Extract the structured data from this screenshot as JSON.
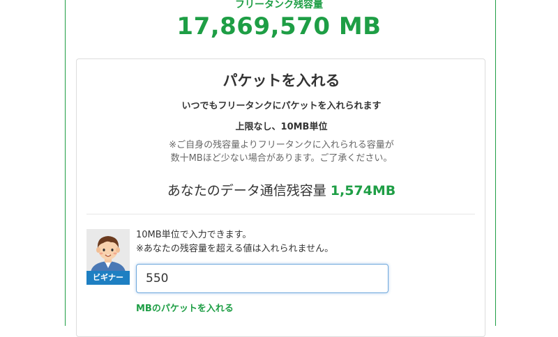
{
  "tank": {
    "label": "フリータンク残容量",
    "amount": "17,869,570 MB"
  },
  "packet_card": {
    "title": "パケットを入れる",
    "subtitle": "いつでもフリータンクにパケットを入れられます",
    "limit_text": "上限なし、10MB単位",
    "note_line1": "※ご自身の残容量よりフリータンクに入れられる容量が",
    "note_line2": "数十MBほど少ない場合があります。ご了承ください。",
    "remaining_label": "あなたのデータ通信残容量",
    "remaining_value": "1,574MB"
  },
  "input_section": {
    "avatar_badge": "ビギナー",
    "hint_line1": "10MB単位で入力できます。",
    "hint_line2": "※あなたの残容量を超える値は入れられません。",
    "amount_value": "550",
    "submit_label": "MBのパケットを入れる"
  },
  "colors": {
    "accent_green": "#1e9e45",
    "badge_blue": "#1e7fc2"
  }
}
